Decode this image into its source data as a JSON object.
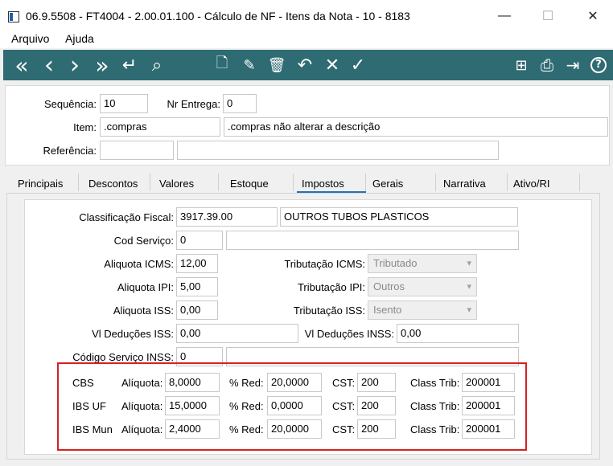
{
  "window": {
    "title": "06.9.5508 - FT4004 - 2.00.01.100 - Cálculo de NF - Itens da Nota - 10 - 8183",
    "minimize_glyph": "—",
    "maximize_glyph": "☐",
    "close_glyph": "✕"
  },
  "menu": [
    "Arquivo",
    "Ajuda"
  ],
  "toolbar": {
    "color": "#2f6b73",
    "icons": {
      "first": "«",
      "prev": "‹",
      "next": "›",
      "last": "»",
      "return": "↵",
      "search": "⌕",
      "new_doc": "🗋",
      "edit": "✎",
      "delete": "🗑",
      "undo": "↶",
      "cancel": "✕",
      "confirm": "✓",
      "tree": "⊞",
      "print": "⎙",
      "exit": "⇥",
      "help": "?"
    }
  },
  "header": {
    "sequencia_label": "Sequência:",
    "sequencia_value": "10",
    "nr_entrega_label": "Nr Entrega:",
    "nr_entrega_value": "0",
    "item_label": "Item:",
    "item_code": ".compras",
    "item_desc": ".compras não alterar a descrição",
    "referencia_label": "Referência:",
    "referencia_code": "",
    "referencia_desc": ""
  },
  "tabs": [
    "Principais",
    "Descontos",
    "Valores",
    "Estoque",
    "Impostos",
    "Gerais",
    "Narrativa",
    "Ativo/RI"
  ],
  "active_tab": "Impostos",
  "impostos": {
    "class_fiscal_label": "Classificação Fiscal:",
    "class_fiscal_code": "3917.39.00",
    "class_fiscal_desc": "OUTROS TUBOS PLASTICOS",
    "cod_servico_label": "Cod Serviço:",
    "cod_servico_value": "0",
    "cod_servico_desc": "",
    "aliq_icms_label": "Aliquota ICMS:",
    "aliq_icms_value": "12,00",
    "trib_icms_label": "Tributação ICMS:",
    "trib_icms_value": "Tributado",
    "aliq_ipi_label": "Aliquota IPI:",
    "aliq_ipi_value": "5,00",
    "trib_ipi_label": "Tributação IPI:",
    "trib_ipi_value": "Outros",
    "aliq_iss_label": "Aliquota ISS:",
    "aliq_iss_value": "0,00",
    "trib_iss_label": "Tributação ISS:",
    "trib_iss_value": "Isento",
    "vl_ded_iss_label": "Vl Deduções ISS:",
    "vl_ded_iss_value": "0,00",
    "vl_ded_inss_label": "Vl Deduções INSS:",
    "vl_ded_inss_value": "0,00",
    "cod_serv_inss_label": "Código Serviço INSS:",
    "cod_serv_inss_value": "0",
    "cod_serv_inss_desc": ""
  },
  "reforma": {
    "highlight_color": "#d62020",
    "aliquota_label": "Alíquota:",
    "red_label": "% Red:",
    "cst_label": "CST:",
    "class_trib_label": "Class Trib:",
    "rows": [
      {
        "name": "CBS",
        "aliquota": "8,0000",
        "red": "20,0000",
        "cst": "200",
        "class_trib": "200001"
      },
      {
        "name": "IBS UF",
        "aliquota": "15,0000",
        "red": "0,0000",
        "cst": "200",
        "class_trib": "200001"
      },
      {
        "name": "IBS Mun",
        "aliquota": "2,4000",
        "red": "20,0000",
        "cst": "200",
        "class_trib": "200001"
      }
    ]
  }
}
